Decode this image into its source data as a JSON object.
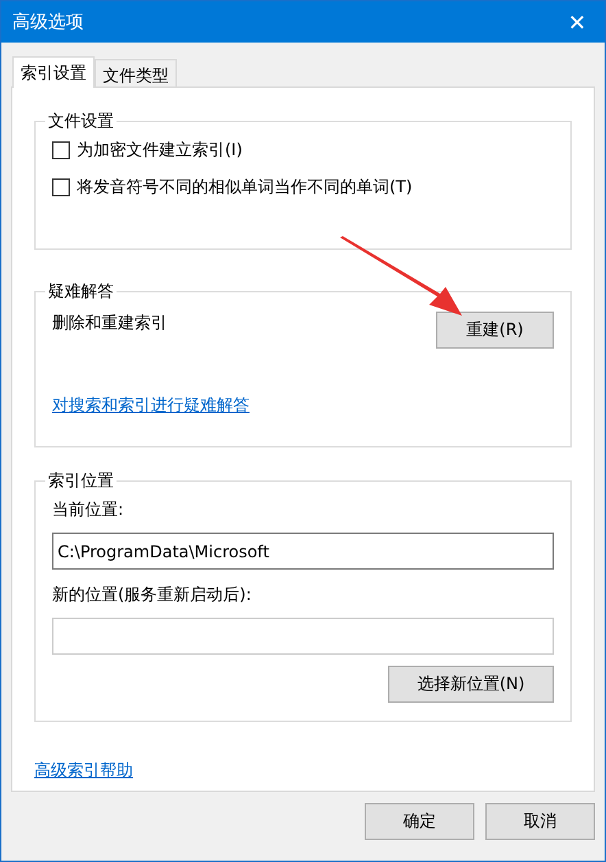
{
  "window": {
    "title": "高级选项",
    "close": "✕"
  },
  "tabs": [
    {
      "label": "索引设置",
      "selected": true
    },
    {
      "label": "文件类型",
      "selected": false
    }
  ],
  "file_settings": {
    "title": "文件设置",
    "options": [
      {
        "label": "为加密文件建立索引(I)",
        "checked": false
      },
      {
        "label": "将发音符号不同的相似单词当作不同的单词(T)",
        "checked": false
      }
    ]
  },
  "troubleshooting": {
    "title": "疑难解答",
    "description": "删除和重建索引",
    "button": "重建(R)",
    "link": "对搜索和索引进行疑难解答"
  },
  "index_location": {
    "title": "索引位置",
    "current_label": "当前位置:",
    "current_value": "C:\\ProgramData\\Microsoft",
    "new_label": "新的位置(服务重新启动后):",
    "button": "选择新位置(N)"
  },
  "help_link": "高级索引帮助",
  "buttons": [
    "确定",
    "取消"
  ],
  "annotations": [
    {
      "kind": "arrow"
    }
  ]
}
